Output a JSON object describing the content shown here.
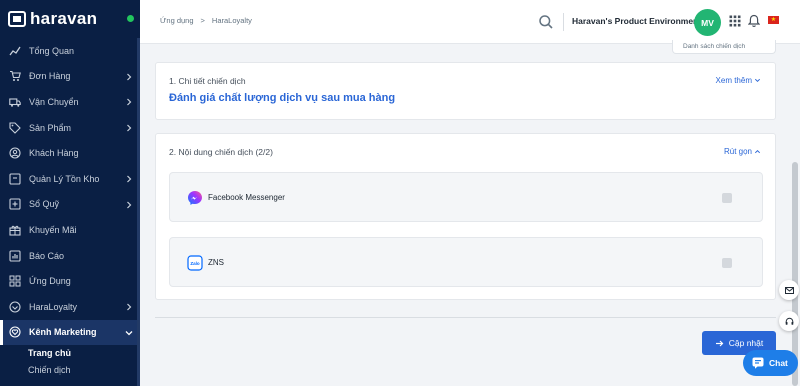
{
  "brand": {
    "name": "haravan"
  },
  "sidebar": {
    "items": [
      {
        "label": "Tổng Quan",
        "icon": "trend-icon",
        "chevron": false
      },
      {
        "label": "Đơn Hàng",
        "icon": "cart-icon",
        "chevron": true
      },
      {
        "label": "Vận Chuyển",
        "icon": "truck-icon",
        "chevron": true
      },
      {
        "label": "Sản Phẩm",
        "icon": "tag-icon",
        "chevron": true
      },
      {
        "label": "Khách Hàng",
        "icon": "user-circle-icon",
        "chevron": false
      },
      {
        "label": "Quản Lý Tồn Kho",
        "icon": "inventory-icon",
        "chevron": true
      },
      {
        "label": "Sổ Quỹ",
        "icon": "cashbook-icon",
        "chevron": true
      },
      {
        "label": "Khuyến Mãi",
        "icon": "gift-icon",
        "chevron": false
      },
      {
        "label": "Báo Cáo",
        "icon": "report-icon",
        "chevron": false
      },
      {
        "label": "Ứng Dụng",
        "icon": "apps-icon",
        "chevron": false
      },
      {
        "label": "HaraLoyalty",
        "icon": "loyalty-icon",
        "chevron": true
      },
      {
        "label": "Kênh Marketing",
        "icon": "heart-icon",
        "chevron": true,
        "active": true
      }
    ],
    "subitems": [
      {
        "label": "Trang chủ",
        "current": true
      },
      {
        "label": "Chiến dịch",
        "current": false
      }
    ]
  },
  "topbar": {
    "breadcrumb": [
      "Ứng dụng",
      "HaraLoyalty"
    ],
    "breadcrumb_sep": ">",
    "environment": "Haravan's Product Environment",
    "avatar_initials": "MV",
    "flag_star": "★"
  },
  "content": {
    "peek_button": "Danh sách chiến dịch",
    "section1": {
      "title": "1. Chi tiết chiến dịch",
      "link": "Xem thêm",
      "campaign_name": "Đánh giá chất lượng dịch vụ sau mua hàng"
    },
    "section2": {
      "title": "2. Nội dung chiến dịch (2/2)",
      "link": "Rút gọn",
      "channels": [
        {
          "label": "Facebook Messenger",
          "icon": "messenger-icon"
        },
        {
          "label": "ZNS",
          "icon": "zalo-icon",
          "icon_text": "Zalo"
        }
      ]
    },
    "update_button": "Cập nhật"
  },
  "chat": {
    "label": "Chat"
  },
  "colors": {
    "sidebar_bg": "#0a1f44",
    "accent": "#2a66d6",
    "avatar": "#22b573",
    "chat": "#1e7ee8"
  }
}
